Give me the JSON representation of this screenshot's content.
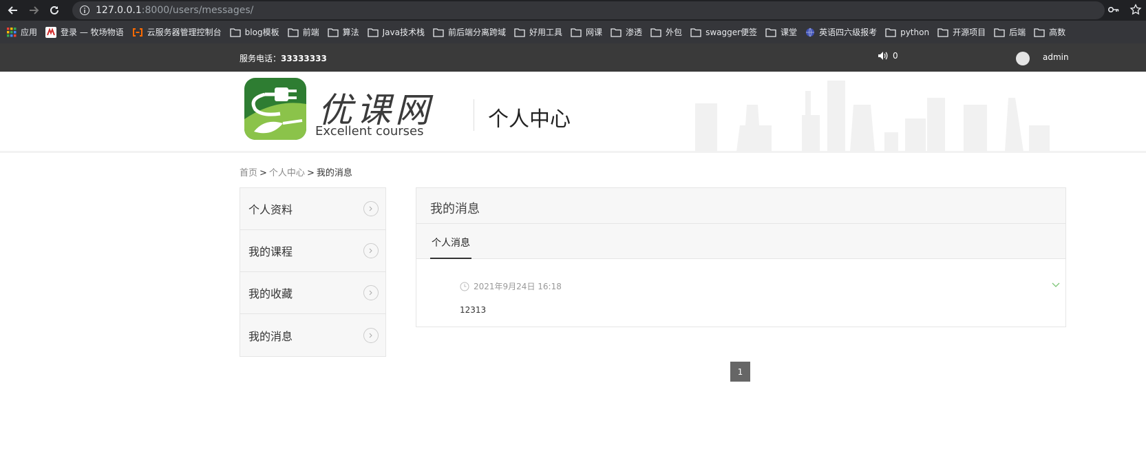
{
  "browser": {
    "url_host": "127.0.0.1",
    "url_path": ":8000/users/messages/",
    "bookmarks": [
      {
        "label": "应用",
        "icon": "apps-grid-icon"
      },
      {
        "label": "登录 — 牧场物语",
        "icon": "site-favicon-icon"
      },
      {
        "label": "云服务器管理控制台",
        "icon": "aliyun-icon"
      },
      {
        "label": "blog模板",
        "icon": "folder-icon"
      },
      {
        "label": "前端",
        "icon": "folder-icon"
      },
      {
        "label": "算法",
        "icon": "folder-icon"
      },
      {
        "label": "Java技术栈",
        "icon": "folder-icon"
      },
      {
        "label": "前后端分离跨域",
        "icon": "folder-icon"
      },
      {
        "label": "好用工具",
        "icon": "folder-icon"
      },
      {
        "label": "网课",
        "icon": "folder-icon"
      },
      {
        "label": "渗透",
        "icon": "folder-icon"
      },
      {
        "label": "外包",
        "icon": "folder-icon"
      },
      {
        "label": "swagger便签",
        "icon": "folder-icon"
      },
      {
        "label": "课堂",
        "icon": "folder-icon"
      },
      {
        "label": "英语四六级报考",
        "icon": "globe-icon"
      },
      {
        "label": "python",
        "icon": "folder-icon"
      },
      {
        "label": "开源项目",
        "icon": "folder-icon"
      },
      {
        "label": "后端",
        "icon": "folder-icon"
      },
      {
        "label": "高数",
        "icon": "folder-icon"
      }
    ]
  },
  "topbar": {
    "phone_label": "服务电话：",
    "phone_number": "33333333",
    "message_count": "0",
    "username": "admin"
  },
  "header": {
    "logo_cn": "优课网",
    "logo_en": "Excellent courses",
    "title": "个人中心"
  },
  "breadcrumb": {
    "home": "首页",
    "center": "个人中心",
    "current": "我的消息",
    "separator": ">"
  },
  "sidebar": {
    "items": [
      {
        "label": "个人资料"
      },
      {
        "label": "我的课程"
      },
      {
        "label": "我的收藏"
      },
      {
        "label": "我的消息"
      }
    ]
  },
  "panel": {
    "title": "我的消息",
    "tab": "个人消息",
    "messages": [
      {
        "date": "2021年9月24日 16:18",
        "body": "12313"
      }
    ]
  },
  "pagination": {
    "current": "1"
  },
  "colors": {
    "topbar": "#3a3a3a",
    "logo_green": "#2e7d32",
    "logo_light_green": "#8bc34a",
    "pager": "#666666"
  }
}
